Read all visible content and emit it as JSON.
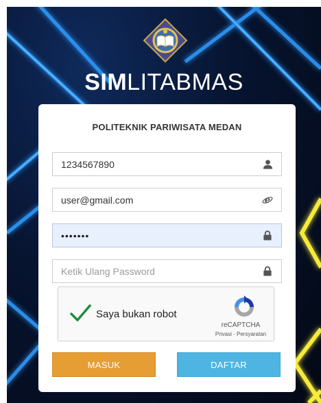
{
  "brand": {
    "bold": "SIM",
    "light": "LITABMAS"
  },
  "form": {
    "institution": "POLITEKNIK PARIWISATA MEDAN",
    "id_value": "1234567890",
    "email_value": "user@gmail.com",
    "password_value": "•••••••",
    "confirm_placeholder": "Ketik Ulang Password"
  },
  "captcha": {
    "label": "Saya bukan robot",
    "brand": "reCAPTCHA",
    "links": "Privasi - Persyaratan"
  },
  "buttons": {
    "login": "MASUK",
    "register": "DAFTAR"
  },
  "icons": {
    "id_field": "user-icon",
    "email_field": "ie-icon",
    "password_field": "lock-icon",
    "confirm_field": "lock-icon"
  },
  "colors": {
    "login_button": "#e69d34",
    "register_button": "#4eb4e1",
    "active_field": "#e8f0fe",
    "check": "#1e8e3e"
  }
}
